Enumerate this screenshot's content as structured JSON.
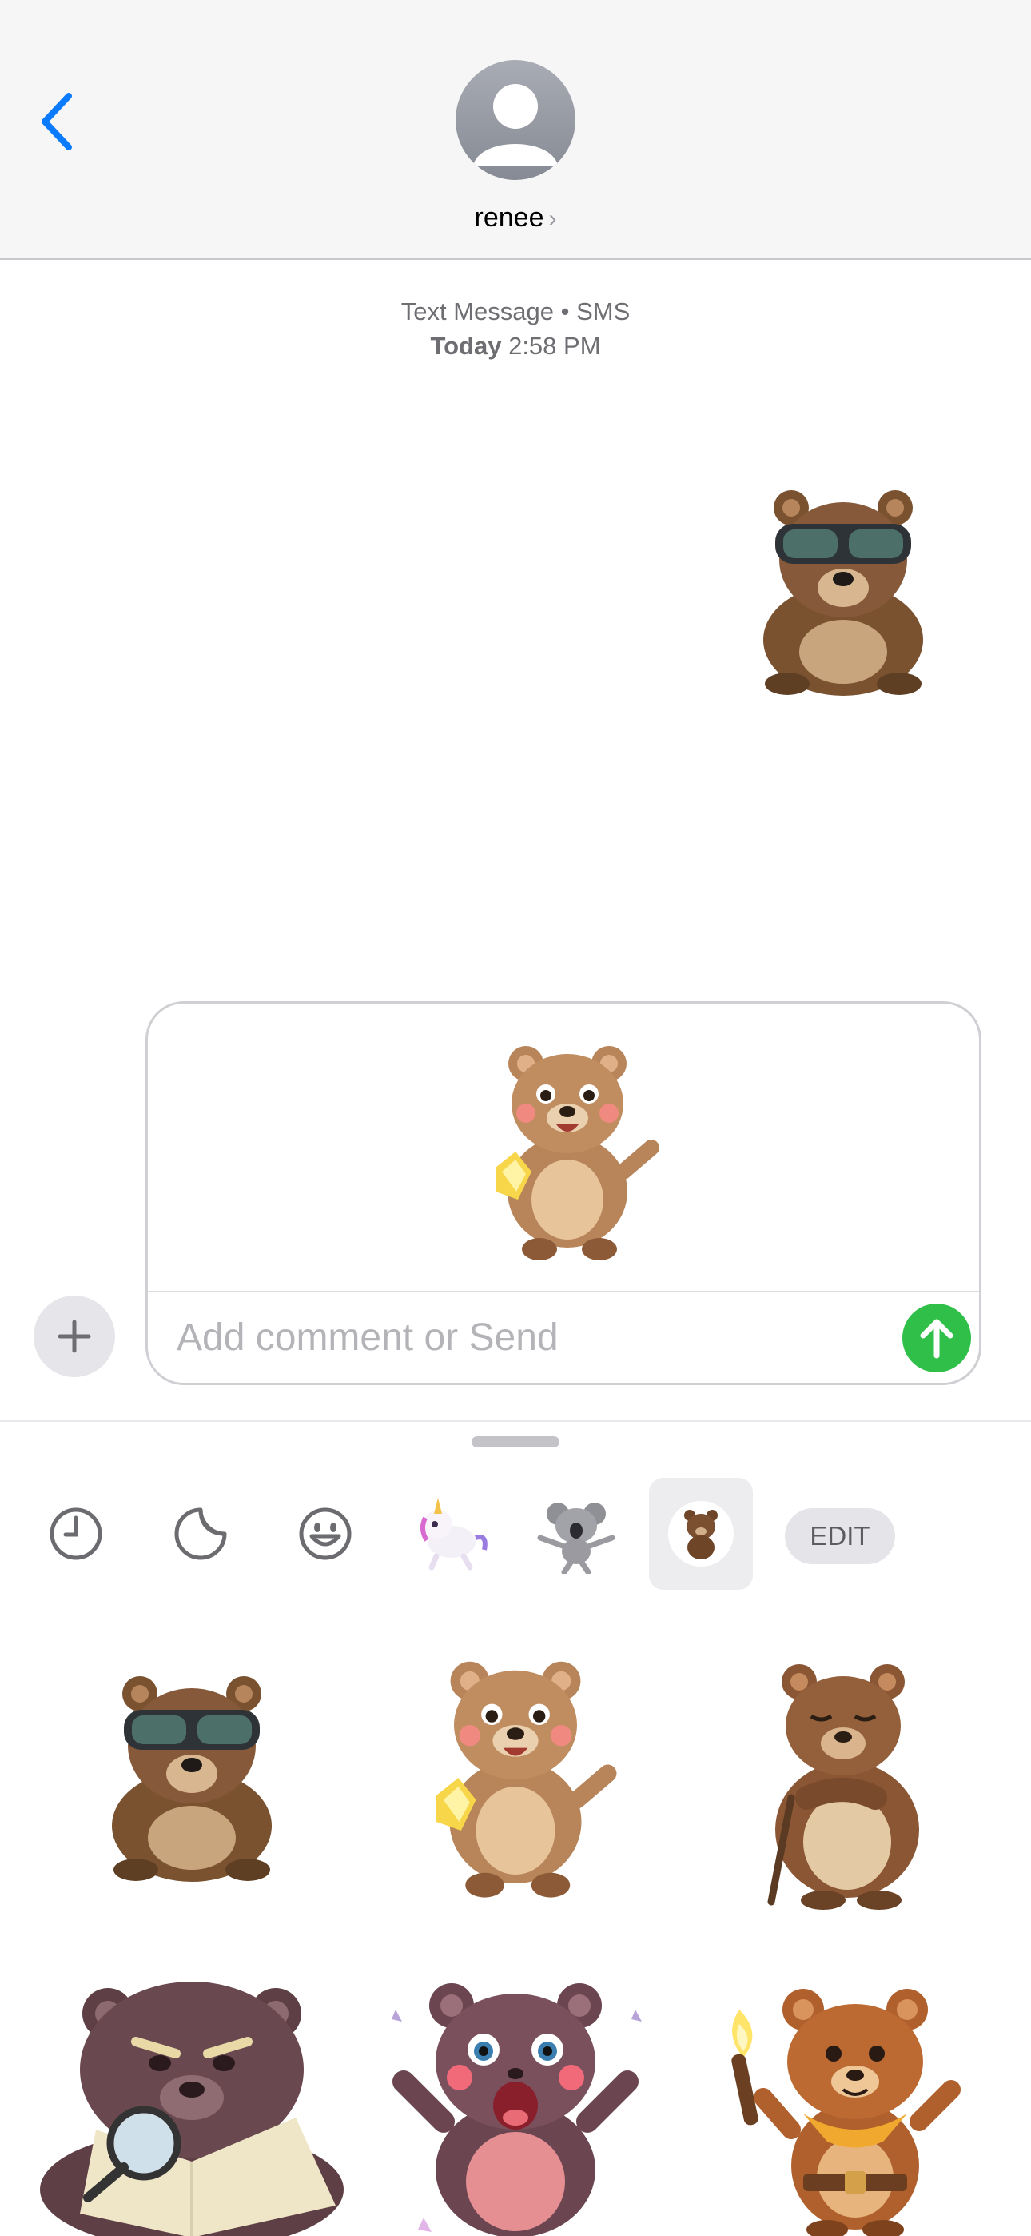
{
  "header": {
    "contact_name": "renee",
    "chevron": "›"
  },
  "conversation": {
    "service_label": "Text Message • SMS",
    "date_label": "Today",
    "time_label": "2:58 PM",
    "sent_sticker": "bear-goggles-sticker"
  },
  "compose": {
    "preview_sticker": "bear-gem-sticker",
    "placeholder": "Add comment or Send"
  },
  "drawer": {
    "tabs": [
      {
        "name": "recents-tab",
        "icon": "clock-icon"
      },
      {
        "name": "stickers-tab",
        "icon": "sticker-peel-icon"
      },
      {
        "name": "emoji-tab",
        "icon": "smiley-icon"
      },
      {
        "name": "unicorn-pack-tab",
        "icon": "unicorn-sticker-icon"
      },
      {
        "name": "koala-pack-tab",
        "icon": "koala-sticker-icon"
      },
      {
        "name": "bear-pack-tab",
        "icon": "bear-sticker-icon",
        "active": true
      }
    ],
    "edit_label": "EDIT",
    "stickers": [
      "bear-goggles-sticker",
      "bear-gem-sticker",
      "bear-sleepy-cane-sticker",
      "bear-map-magnifier-sticker",
      "bear-surprised-sticker",
      "bear-torch-explorer-sticker"
    ]
  },
  "colors": {
    "accent_blue": "#0a7aff",
    "send_green": "#30c04a",
    "bear_brown": "#8b5a36"
  }
}
